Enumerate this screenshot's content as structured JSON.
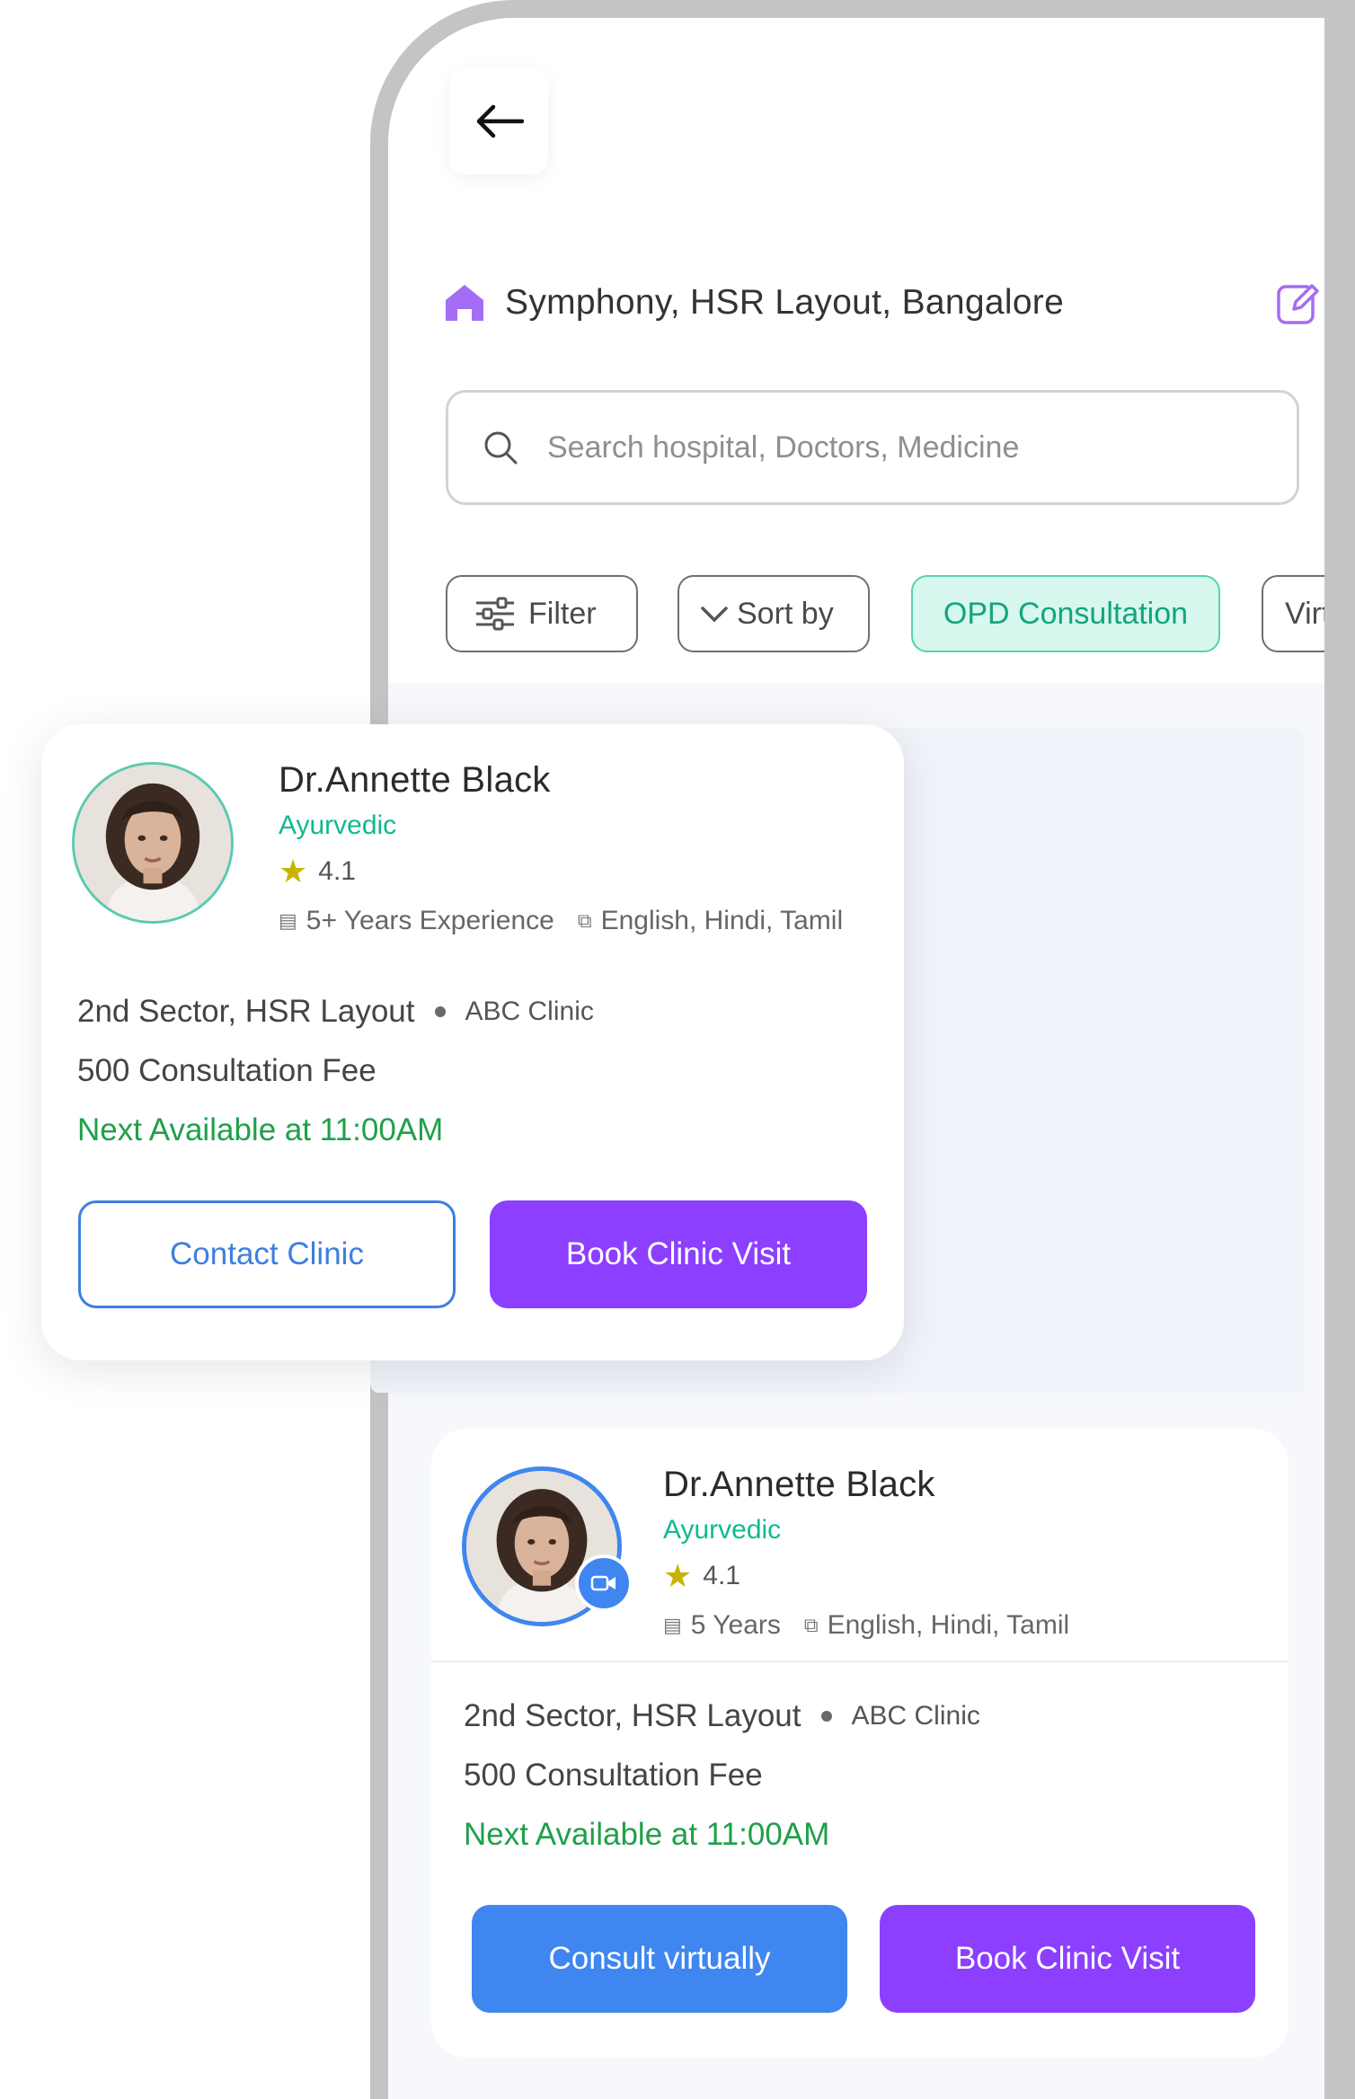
{
  "header": {
    "location": "Symphony, HSR Layout, Bangalore"
  },
  "search": {
    "placeholder": "Search hospital, Doctors, Medicine"
  },
  "chips": [
    {
      "label": "Filter",
      "active": false
    },
    {
      "label": "Sort by",
      "active": false
    },
    {
      "label": "OPD Consultation",
      "active": true
    },
    {
      "label": "Virtual",
      "active": false
    }
  ],
  "doctors": [
    {
      "name": "Dr.Annette Black",
      "specialty": "Ayurvedic",
      "rating": "4.1",
      "experience": "5+ Years Experience",
      "languages": "English, Hindi, Tamil",
      "address": "2nd Sector, HSR Layout",
      "clinic": "ABC Clinic",
      "fee": "500 Consultation Fee",
      "availability": "Next Available at 11:00AM",
      "secondary_button": "Contact Clinic",
      "primary_button": "Book Clinic Visit"
    },
    {
      "name": "Dr.Annette Black",
      "specialty": "Ayurvedic",
      "rating": "4.1",
      "experience": "5 Years",
      "languages": "English, Hindi, Tamil",
      "address": "2nd Sector, HSR Layout",
      "clinic": "ABC Clinic",
      "fee": "500 Consultation Fee",
      "availability": "Next Available at 11:00AM",
      "secondary_button": "Consult virtually",
      "primary_button": "Book Clinic Visit"
    }
  ],
  "colors": {
    "accent_purple": "#8c3fff",
    "accent_blue": "#3f86f0",
    "accent_green": "#1fa04a",
    "specialty_teal": "#10b98f"
  }
}
